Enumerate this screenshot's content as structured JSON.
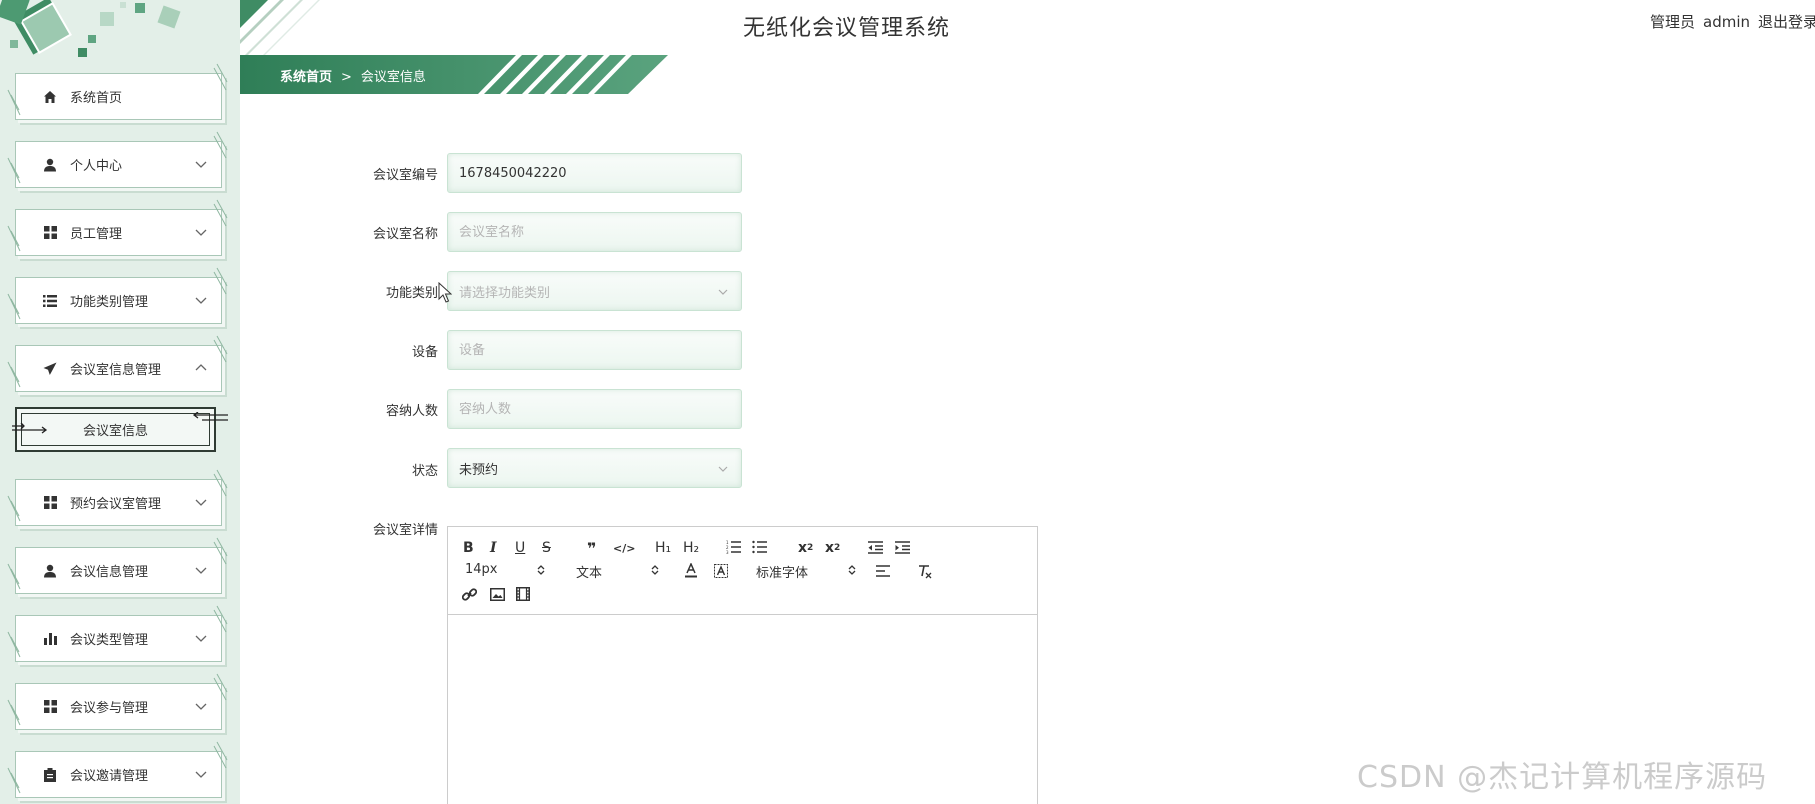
{
  "header": {
    "title": "无纸化会议管理系统",
    "user_role": "管理员",
    "username": "admin",
    "logout_label": "退出登录"
  },
  "breadcrumb": {
    "home": "系统首页",
    "separator": ">",
    "current": "会议室信息"
  },
  "sidebar": {
    "items": [
      {
        "label": "系统首页",
        "icon": "home-icon"
      },
      {
        "label": "个人中心",
        "icon": "user-icon"
      },
      {
        "label": "员工管理",
        "icon": "grid-icon"
      },
      {
        "label": "功能类别管理",
        "icon": "list-icon"
      },
      {
        "label": "会议室信息管理",
        "icon": "paper-plane-icon"
      },
      {
        "label": "预约会议室管理",
        "icon": "grid-icon"
      },
      {
        "label": "会议信息管理",
        "icon": "user-icon"
      },
      {
        "label": "会议类型管理",
        "icon": "bar-chart-icon"
      },
      {
        "label": "会议参与管理",
        "icon": "grid-icon"
      },
      {
        "label": "会议邀请管理",
        "icon": "clipboard-icon"
      }
    ],
    "active_sub_item": "会议室信息"
  },
  "form": {
    "room_no": {
      "label": "会议室编号",
      "value": "1678450042220"
    },
    "room_name": {
      "label": "会议室名称",
      "placeholder": "会议室名称"
    },
    "category": {
      "label": "功能类别",
      "placeholder": "请选择功能类别"
    },
    "equipment": {
      "label": "设备",
      "placeholder": "设备"
    },
    "capacity": {
      "label": "容纳人数",
      "placeholder": "容纳人数"
    },
    "status": {
      "label": "状态",
      "value": "未预约"
    },
    "details": {
      "label": "会议室详情"
    }
  },
  "editor": {
    "font_size": "14px",
    "paragraph": "文本",
    "font_family": "标准字体",
    "buttons": [
      "bold",
      "italic",
      "underline",
      "strike",
      "blockquote",
      "code-block",
      "header-1",
      "header-2",
      "ordered-list",
      "bullet-list",
      "subscript",
      "superscript",
      "outdent",
      "indent",
      "color",
      "background",
      "align",
      "clean",
      "link",
      "image",
      "video"
    ]
  },
  "watermark": "CSDN @杰记计算机程序源码",
  "colors": {
    "primary_green": "#3f8c64",
    "sidebar_bg": "#e3efe8",
    "field_border": "#c9e3d3"
  }
}
